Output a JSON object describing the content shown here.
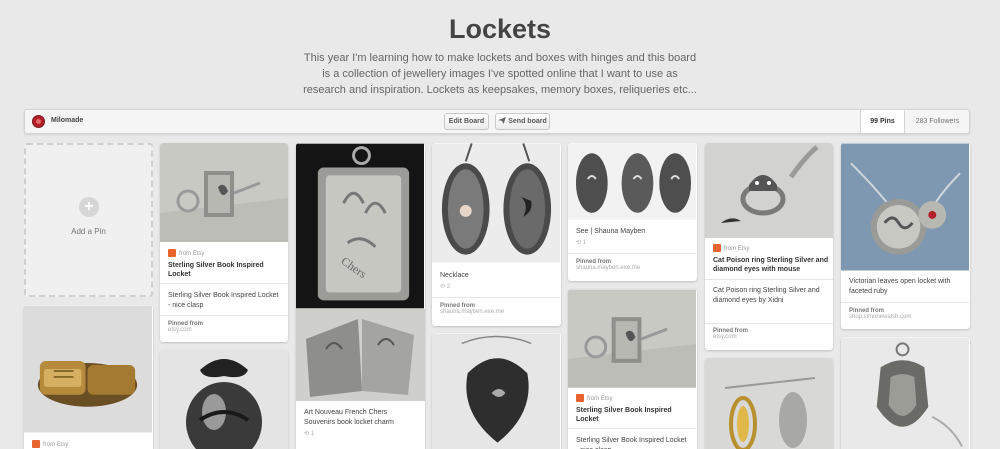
{
  "board": {
    "title": "Lockets",
    "description": "This year I'm learning how to make lockets and boxes with hinges and this board is a collection of jewellery images I've spotted online that I want to use as research and inspiration. Lockets as keepsakes, memory boxes, reliqueries etc..."
  },
  "toolbar": {
    "owner": "Milomade",
    "edit_label": "Edit Board",
    "send_label": "Send board",
    "pins_count": "99 Pins",
    "followers_count": "283 Followers"
  },
  "add_pin": {
    "label": "Add a Pin"
  },
  "pins": [
    {
      "source": "from Etsy",
      "title": "Sterling Silver Book Inspired Locket",
      "description": "Sterling Silver Book Inspired Locket - nice clasp",
      "pinned_label": "Pinned from",
      "domain": "etsy.com"
    },
    {
      "description": "Art Nouveau French Chers Souvenirs book locket charm",
      "meta": "1"
    },
    {
      "description": "Necklace",
      "meta": "2",
      "pinned_label": "Pinned from",
      "domain": "shauna.mayben.exe.me"
    },
    {
      "description": "See | Shauna Mayben",
      "meta": "1",
      "pinned_label": "Pinned from",
      "domain": "shauna.mayben.exe.me"
    },
    {
      "source": "from Etsy",
      "title": "Sterling Silver Book Inspired Locket",
      "description": "Sterling Silver Book Inspired Locket - nice clasp"
    },
    {
      "source": "from Etsy",
      "title": "Cat Poison ring Sterling Silver and diamond eyes with mouse",
      "description": "Cat Poison ring Sterling Silver and diamond eyes by Xidni",
      "pinned_label": "Pinned from",
      "domain": "etsy.com"
    },
    {
      "description": "Victorian leaves open locket with faceted ruby",
      "pinned_label": "Pinned from",
      "domain": "shop.simonewalsh.com"
    },
    {
      "source": "from Etsy"
    }
  ],
  "colors": {
    "background": "#e9e9e9",
    "accent": "#b3202a",
    "etsy": "#e8642e"
  }
}
